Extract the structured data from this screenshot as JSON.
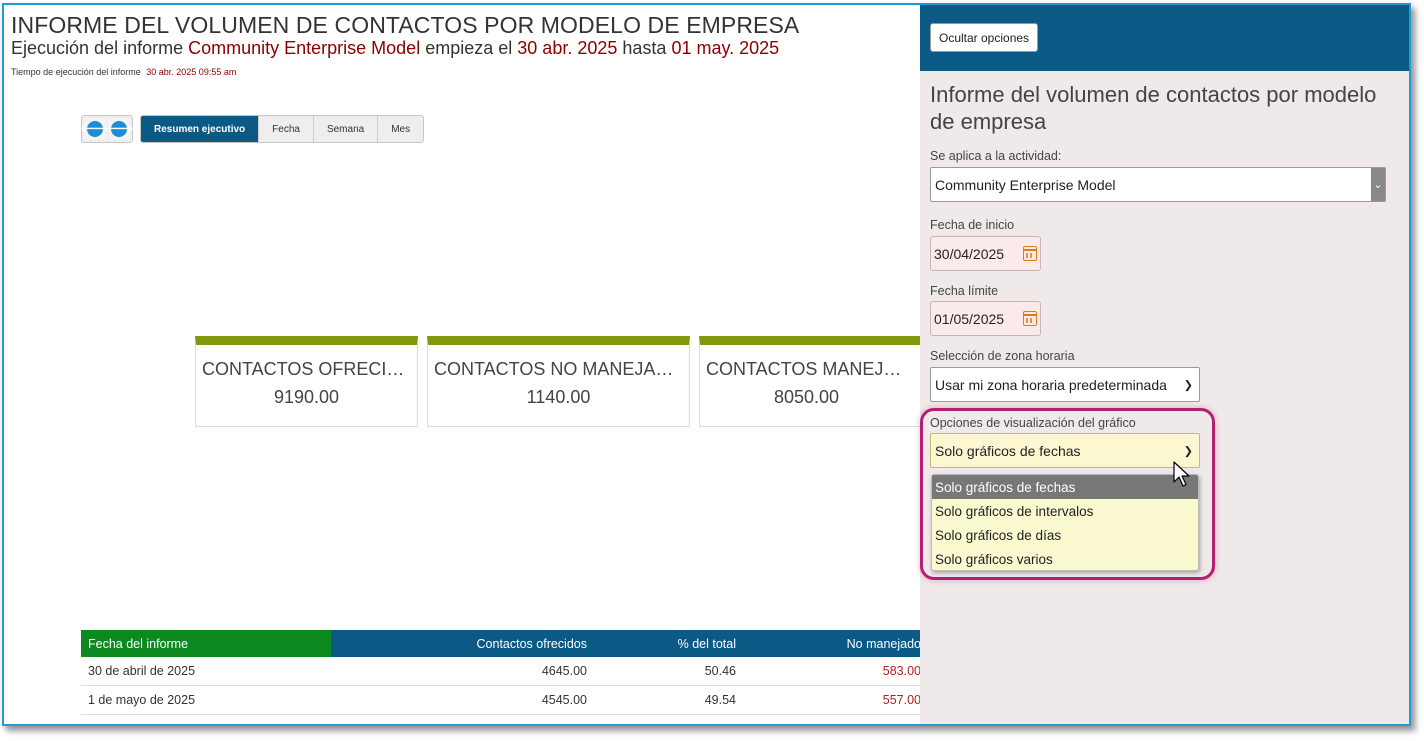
{
  "report": {
    "title": "INFORME DEL VOLUMEN DE CONTACTOS POR MODELO DE EMPRESA",
    "subtitle_prefix": "Ejecución del informe",
    "model": "Community Enterprise Model",
    "subtitle_mid": "empieza el",
    "start_date": "30 abr. 2025",
    "subtitle_until": "hasta",
    "end_date": "01 may. 2025",
    "run_time_label": "Tiempo de ejecución del informe",
    "run_time_value": "30 abr. 2025 09:55 am"
  },
  "nav": {
    "prev_icon": "arrow-left-icon",
    "next_icon": "arrow-right-icon",
    "prev_glyph": "🡐",
    "next_glyph": "🡒"
  },
  "tabs": [
    {
      "label": "Resumen ejecutivo",
      "active": true
    },
    {
      "label": "Fecha",
      "active": false
    },
    {
      "label": "Semana",
      "active": false
    },
    {
      "label": "Mes",
      "active": false
    }
  ],
  "cards": [
    {
      "title": "CONTACTOS OFRECIDOS",
      "value": "9190.00"
    },
    {
      "title": "CONTACTOS NO MANEJADOS",
      "value": "1140.00"
    },
    {
      "title": "CONTACTOS MANEJADOS",
      "value": "8050.00"
    }
  ],
  "table": {
    "headers": [
      "Fecha del informe",
      "Contactos ofrecidos",
      "% del total",
      "No manejado"
    ],
    "rows": [
      [
        "30 de abril de 2025",
        "4645.00",
        "50.46",
        "583.00"
      ],
      [
        "1 de mayo de 2025",
        "4545.00",
        "49.54",
        "557.00"
      ]
    ]
  },
  "options": {
    "hide_button": "Ocultar opciones",
    "title": "Informe del volumen de contactos por modelo de empresa",
    "activity_label": "Se aplica a la actividad:",
    "activity_value": "Community Enterprise Model",
    "start_label": "Fecha de inicio",
    "start_value": "30/04/2025",
    "end_label": "Fecha límite",
    "end_value": "01/05/2025",
    "tz_label": "Selección de zona horaria",
    "tz_value": "Usar mi zona horaria predeterminada",
    "chart_label": "Opciones de visualización del gráfico",
    "chart_value": "Solo gráficos de fechas",
    "chart_options": [
      "Solo gráficos de fechas",
      "Solo gráficos de intervalos",
      "Solo gráficos de días",
      "Solo gráficos varios"
    ],
    "highlight_color": "#b3206f"
  },
  "colors": {
    "brand_blue": "#0b5a86",
    "card_accent": "#7f9a0b",
    "header_green": "#0d8a1f",
    "dark_red": "#8b0000"
  }
}
